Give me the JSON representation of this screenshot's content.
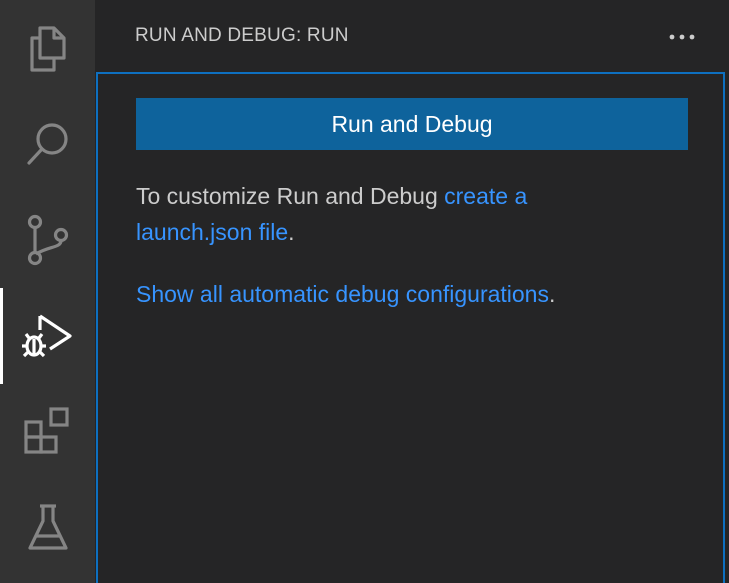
{
  "activity_bar": {
    "items": [
      {
        "name": "explorer",
        "icon": "files-icon"
      },
      {
        "name": "search",
        "icon": "search-icon"
      },
      {
        "name": "source-control",
        "icon": "source-control-icon"
      },
      {
        "name": "run-and-debug",
        "icon": "run-debug-icon",
        "active": true
      },
      {
        "name": "extensions",
        "icon": "extensions-icon"
      },
      {
        "name": "testing",
        "icon": "beaker-icon"
      }
    ],
    "icon_color": "#858585",
    "active_icon_color": "#ffffff"
  },
  "sidebar": {
    "title": "RUN AND DEBUG: RUN",
    "more_icon": "ellipsis-icon",
    "run_button_label": "Run and Debug",
    "customize_prefix": "To customize Run and Debug ",
    "launch_link": "create a launch.json file",
    "customize_suffix": ".",
    "show_all_link": "Show all automatic debug configurations",
    "show_all_suffix": "."
  },
  "colors": {
    "accent": "#0e639c",
    "focus_border": "#0e70c0",
    "link": "#3794ff"
  }
}
